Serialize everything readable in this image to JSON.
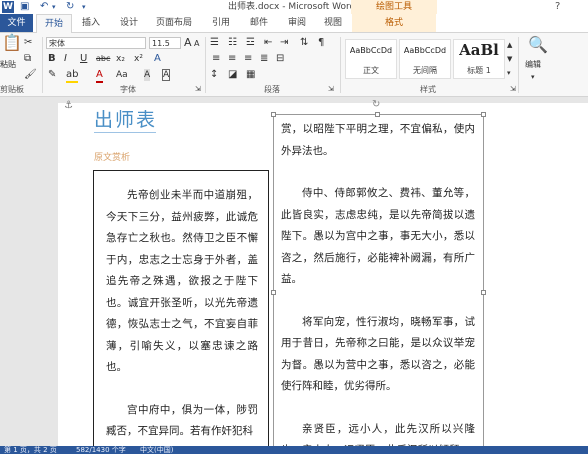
{
  "window": {
    "title": "出师表.docx - Microsoft Word",
    "context_tools": "绘图工具",
    "help": "?",
    "word_logo": "W"
  },
  "qat": {
    "save": "💾",
    "undo": "↶",
    "redo": "↻"
  },
  "tabs": [
    {
      "label": "文件"
    },
    {
      "label": "开始"
    },
    {
      "label": "插入"
    },
    {
      "label": "设计"
    },
    {
      "label": "页面布局"
    },
    {
      "label": "引用"
    },
    {
      "label": "邮件"
    },
    {
      "label": "审阅"
    },
    {
      "label": "视图"
    },
    {
      "label": "格式"
    }
  ],
  "ribbon": {
    "clipboard": {
      "paste_label": "粘贴",
      "group_label": "剪贴板"
    },
    "font": {
      "font_name": "宋体",
      "font_size": "11.5",
      "group_label": "字体",
      "grow": "A",
      "shrink": "A",
      "aa": "Aa",
      "bold": "B",
      "italic": "I",
      "underline": "U",
      "strike": "abc",
      "sub": "x₂",
      "sup": "x²",
      "font_color": "A"
    },
    "paragraph": {
      "group_label": "段落"
    },
    "styles": {
      "group_label": "样式",
      "items": [
        {
          "sample": "AaBbCcDd",
          "name": "正文"
        },
        {
          "sample": "AaBbCcDd",
          "name": "无间隔"
        },
        {
          "sample": "AaBl",
          "name": "标题 1"
        }
      ]
    },
    "editing": {
      "label": "编辑"
    }
  },
  "document": {
    "title": "出师表",
    "subtitle": "原文赏析",
    "left_paragraphs": [
      "先帝创业未半而中道崩殂，今天下三分，益州疲弊，此诚危急存亡之秋也。然侍卫之臣不懈于内，忠志之士忘身于外者，盖追先帝之殊遇，欲报之于陛下也。诚宜开张圣听，以光先帝遗德，恢弘志士之气，不宜妄自菲薄，引喻失义，以塞忠谏之路也。",
      "宫中府中，俱为一体，陟罚臧否，不宜异同。若有作奸犯科"
    ],
    "right_paragraphs": [
      "赏，以昭陛下平明之理，不宜偏私，使内外异法也。",
      "侍中、侍郎郭攸之、费祎、董允等，此皆良实，志虑忠纯，是以先帝简拔以遗陛下。愚以为宫中之事，事无大小，悉以咨之，然后施行，必能裨补阙漏，有所广益。",
      "将军向宠，性行淑均，晓畅军事，试用于昔日，先帝称之曰能，是以众议举宠为督。愚以为营中之事，悉以咨之，必能使行阵和睦，优劣得所。",
      "亲贤臣，远小人，此先汉所以兴隆也；亲小人，远贤臣，此后汉所以倾颓"
    ]
  },
  "status": {
    "left": "第 1 页，共 2 页",
    "mid": "582/1430 个字",
    "lang": "中文(中国)"
  }
}
